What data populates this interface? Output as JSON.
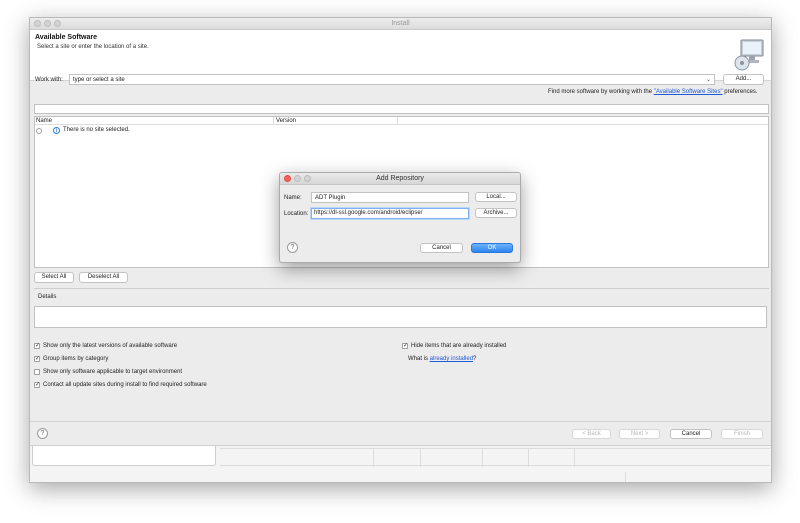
{
  "window": {
    "title": "Install"
  },
  "header": {
    "title": "Available Software",
    "subtitle": "Select a site or enter the location of a site."
  },
  "work_with": {
    "label": "Work with:",
    "value": "type or select a site",
    "add_label": "Add...",
    "more_prefix": "Find more software by working with the ",
    "more_link": "\"Available Software Sites\"",
    "more_suffix": " preferences."
  },
  "table": {
    "columns": [
      "Name",
      "Version"
    ],
    "empty_message": "There is no site selected."
  },
  "selection": {
    "select_all": "Select All",
    "deselect_all": "Deselect All"
  },
  "details": {
    "label": "Details"
  },
  "options": {
    "latest_versions": {
      "label": "Show only the latest versions of available software",
      "checked": true
    },
    "group_by_category": {
      "label": "Group items by category",
      "checked": true
    },
    "applicable_only": {
      "label": "Show only software applicable to target environment",
      "checked": false
    },
    "contact_sites": {
      "label": "Contact all update sites during install to find required software",
      "checked": true
    },
    "hide_installed": {
      "label": "Hide items that are already installed",
      "checked": true
    },
    "what_is_prefix": "What is ",
    "what_is_link": "already installed",
    "what_is_suffix": "?"
  },
  "footer": {
    "back": "< Back",
    "next": "Next >",
    "cancel": "Cancel",
    "finish": "Finish"
  },
  "dialog": {
    "title": "Add Repository",
    "name_label": "Name:",
    "name_value": "ADT Plugin",
    "local_label": "Local...",
    "location_label": "Location:",
    "location_value": "https://dl-ssl.google.com/android/eclipse/",
    "archive_label": "Archive...",
    "cancel_label": "Cancel",
    "ok_label": "OK"
  },
  "colors": {
    "accent": "#3b8ff5",
    "link": "#1d59d8",
    "close_red": "#fc605c"
  }
}
